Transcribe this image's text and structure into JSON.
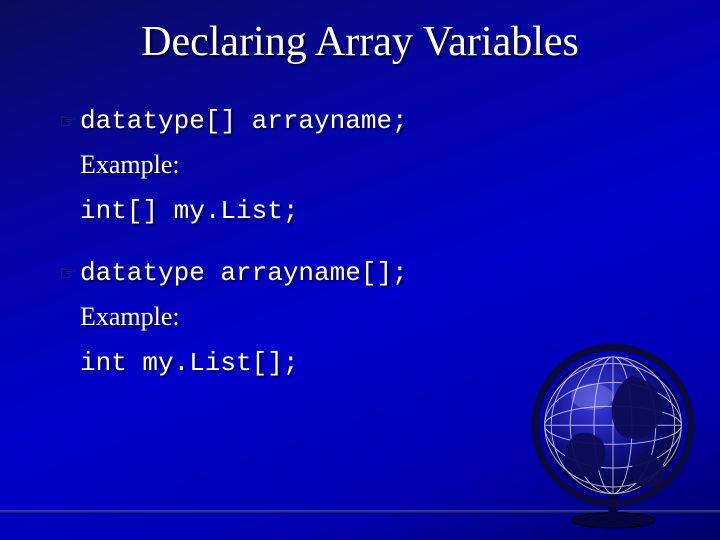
{
  "title": "Declaring Array Variables",
  "bullets": [
    {
      "syntax": "datatype[] arrayname;",
      "example_label": "Example:",
      "example_code": "int[] my.List;"
    },
    {
      "syntax": "datatype arrayname[];",
      "example_label": "Example:",
      "example_code": "int my.List[];"
    }
  ],
  "icons": {
    "bullet": "☞"
  }
}
